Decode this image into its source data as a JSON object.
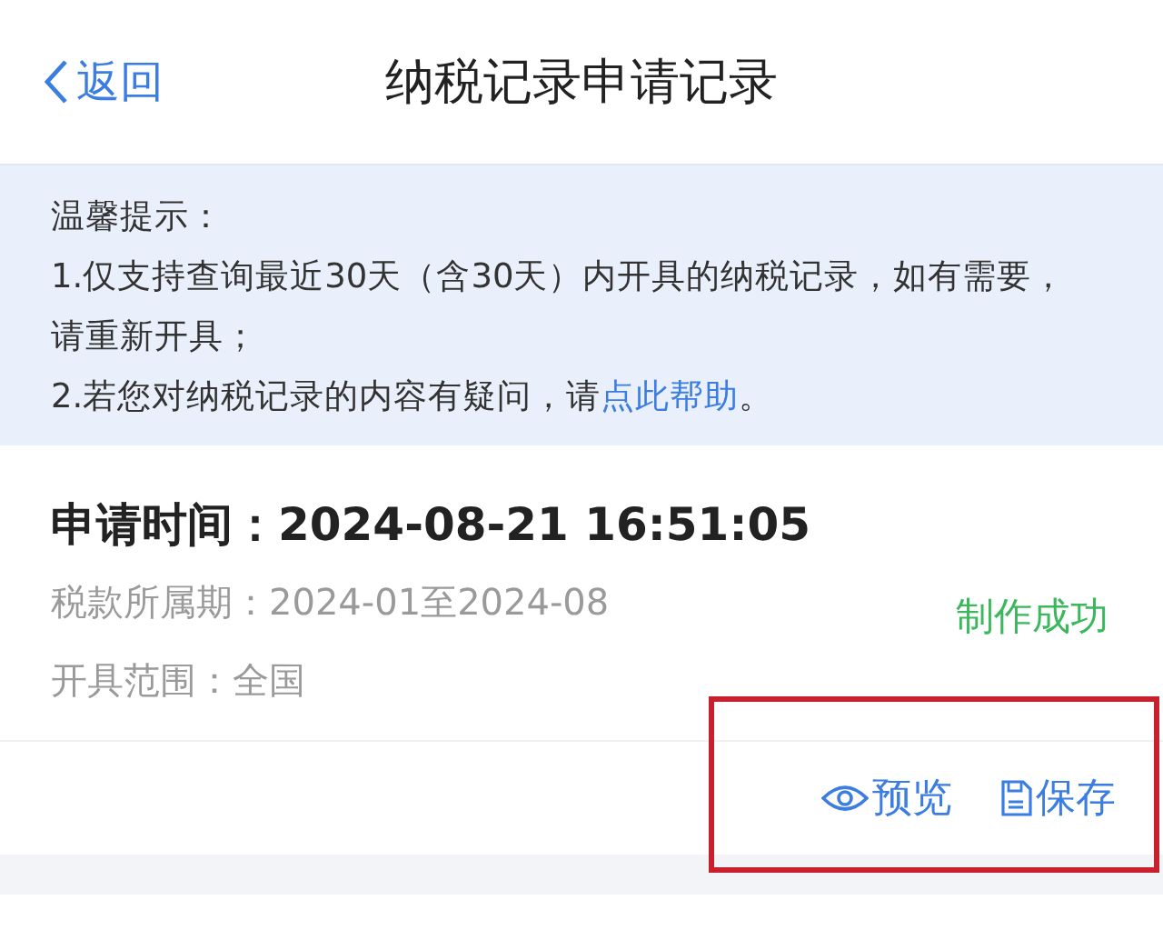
{
  "nav": {
    "back": "返回",
    "title": "纳税记录申请记录"
  },
  "notice": {
    "heading": "温馨提示：",
    "items": [
      {
        "text": "1.仅支持查询最近30天（含30天）内开具的纳税记录，如有需要，请重新开具；"
      },
      {
        "text": "2.若您对纳税记录的内容有疑问，请",
        "link": "点此帮助",
        "after": "。"
      }
    ]
  },
  "record": {
    "title": "申请时间：2024-08-21 16:51:05",
    "fields": [
      "税款所属期：2024-01至2024-08",
      "开具范围：全国"
    ],
    "status": "制作成功",
    "actions": [
      {
        "kind": "preview",
        "label": "预览"
      },
      {
        "kind": "save",
        "label": "保存"
      }
    ]
  }
}
